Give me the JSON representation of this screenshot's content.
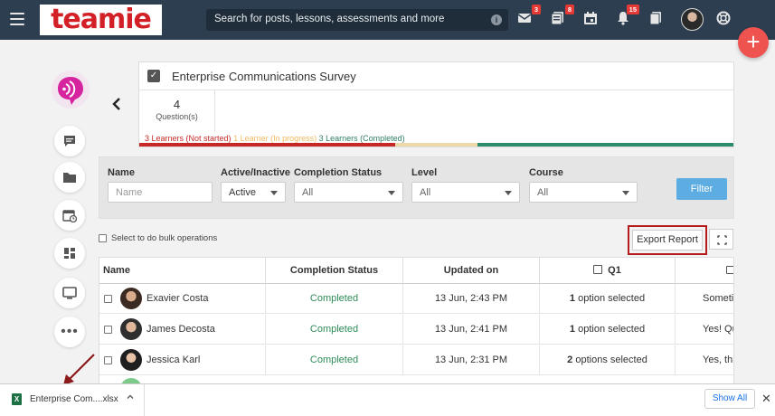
{
  "header": {
    "logo_text": "teamie",
    "search_placeholder": "Search for posts, lessons, assessments and more",
    "badges": {
      "messages": "3",
      "posts": "8",
      "notifications": "15"
    }
  },
  "page": {
    "back_label": "‹"
  },
  "survey": {
    "title": "Enterprise Communications Survey",
    "question_count": "4",
    "question_label": "Question(s)",
    "status_not_started": "3 Learners (Not started)",
    "status_in_progress": "1 Learner (In progress)",
    "status_completed": "3 Learners (Completed)",
    "progress_fractions": {
      "not_started": 0.43,
      "in_progress": 0.14,
      "completed": 0.43
    },
    "colors": {
      "not_started": "#c62828",
      "in_progress": "#f0d9a8",
      "completed": "#2e8b6e"
    }
  },
  "filters": {
    "name_label": "Name",
    "name_placeholder": "Name",
    "active_label": "Active/Inactive",
    "active_value": "Active",
    "completion_label": "Completion Status",
    "completion_value": "All",
    "level_label": "Level",
    "level_value": "All",
    "course_label": "Course",
    "course_value": "All",
    "filter_button": "Filter"
  },
  "bulk": {
    "label": "Select to do bulk operations"
  },
  "export": {
    "label": "Export Report"
  },
  "table": {
    "headers": {
      "name": "Name",
      "completion": "Completion Status",
      "updated": "Updated on",
      "q1": "Q1"
    },
    "rows": [
      {
        "name": "Exavier Costa",
        "status": "Completed",
        "updated": "13 Jun, 2:43 PM",
        "q1_count": "1",
        "q1_text": "option selected",
        "q2": "Sometin"
      },
      {
        "name": "James Decosta",
        "status": "Completed",
        "updated": "13 Jun, 2:41 PM",
        "q1_count": "1",
        "q1_text": "option selected",
        "q2": "Yes! Qu"
      },
      {
        "name": "Jessica Karl",
        "status": "Completed",
        "updated": "13 Jun, 2:31 PM",
        "q1_count": "2",
        "q1_text": "options selected",
        "q2": "Yes, th"
      }
    ]
  },
  "download": {
    "file_name": "Enterprise Com....xlsx",
    "show_all": "Show All"
  }
}
